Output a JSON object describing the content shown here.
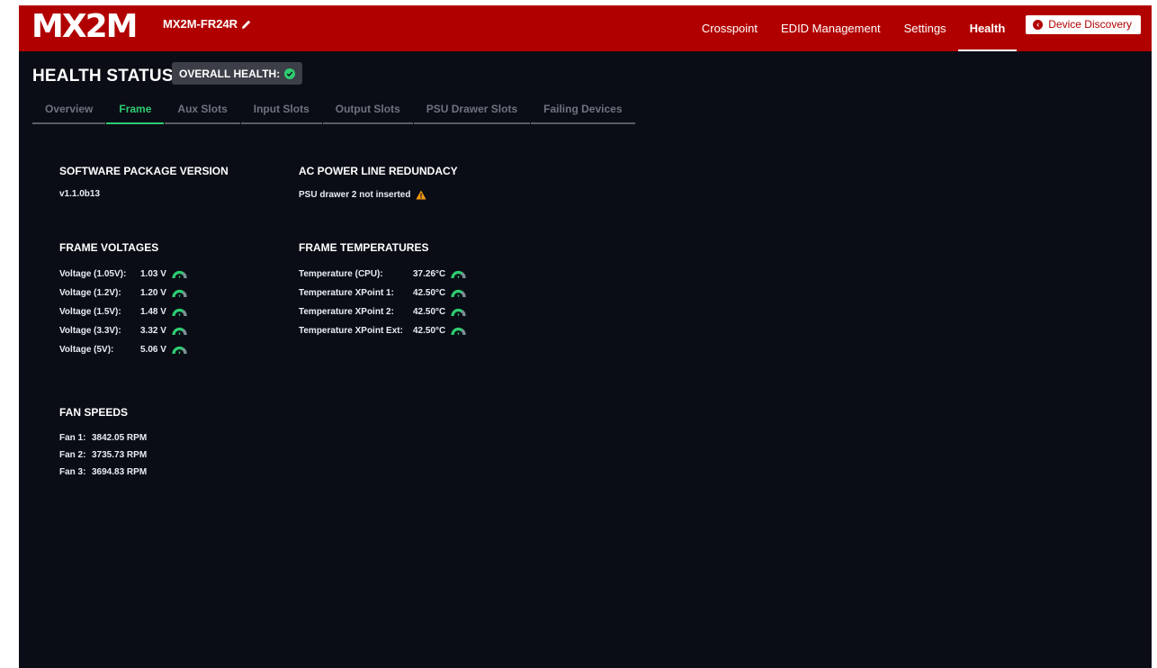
{
  "app": {
    "logo": "MX2M",
    "device_name": "MX2M-FR24R"
  },
  "nav": {
    "items": [
      {
        "label": "Crosspoint"
      },
      {
        "label": "EDID Management"
      },
      {
        "label": "Settings"
      },
      {
        "label": "Health"
      }
    ],
    "active": "Health",
    "discovery_label": "Device Discovery"
  },
  "health": {
    "title": "HEALTH STATUS",
    "overall_label": "OVERALL HEALTH:",
    "overall_status": "ok"
  },
  "tabs": [
    {
      "label": "Overview"
    },
    {
      "label": "Frame"
    },
    {
      "label": "Aux Slots"
    },
    {
      "label": "Input Slots"
    },
    {
      "label": "Output Slots"
    },
    {
      "label": "PSU Drawer Slots"
    },
    {
      "label": "Failing Devices"
    }
  ],
  "active_tab": "Frame",
  "software": {
    "title": "SOFTWARE PACKAGE VERSION",
    "version": "v1.1.0b13"
  },
  "ac_power": {
    "title": "AC POWER LINE REDUNDACY",
    "status": "PSU drawer 2 not inserted",
    "icon": "warning-icon"
  },
  "voltages": {
    "title": "FRAME VOLTAGES",
    "rows": [
      {
        "label": "Voltage (1.05V):",
        "value": "1.03 V"
      },
      {
        "label": "Voltage (1.2V):",
        "value": "1.20 V"
      },
      {
        "label": "Voltage (1.5V):",
        "value": "1.48 V"
      },
      {
        "label": "Voltage (3.3V):",
        "value": "3.32 V"
      },
      {
        "label": "Voltage (5V):",
        "value": "5.06 V"
      }
    ]
  },
  "temperatures": {
    "title": "FRAME TEMPERATURES",
    "rows": [
      {
        "label": "Temperature (CPU):",
        "value": "37.26°C"
      },
      {
        "label": "Temperature XPoint 1:",
        "value": "42.50°C"
      },
      {
        "label": "Temperature XPoint 2:",
        "value": "42.50°C"
      },
      {
        "label": "Temperature XPoint Ext:",
        "value": "42.50°C"
      }
    ]
  },
  "fans": {
    "title": "FAN SPEEDS",
    "rows": [
      {
        "label": "Fan 1:",
        "value": "3842.05 RPM"
      },
      {
        "label": "Fan 2:",
        "value": "3735.73 RPM"
      },
      {
        "label": "Fan 3:",
        "value": "3694.83 RPM"
      }
    ]
  },
  "colors": {
    "brand_red": "#b10000",
    "background": "#0b0d16",
    "ok_green": "#2ecc71",
    "warning_orange": "#f39c12"
  }
}
